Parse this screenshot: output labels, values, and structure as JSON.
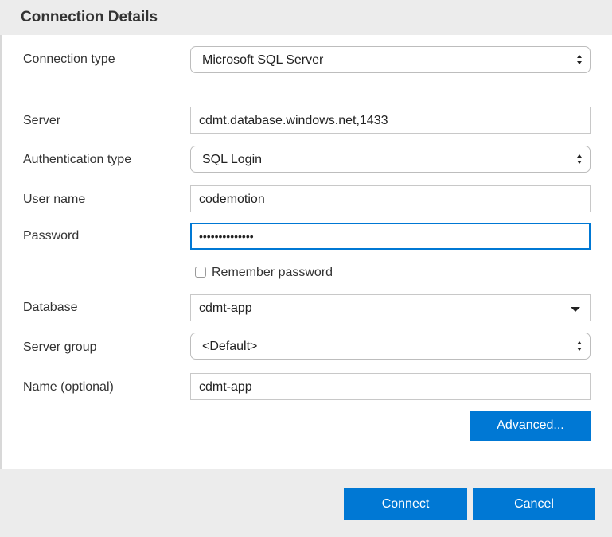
{
  "header": {
    "title": "Connection Details"
  },
  "form": {
    "connection_type": {
      "label": "Connection type",
      "value": "Microsoft SQL Server"
    },
    "server": {
      "label": "Server",
      "value": "cdmt.database.windows.net,1433"
    },
    "auth_type": {
      "label": "Authentication type",
      "value": "SQL Login"
    },
    "user_name": {
      "label": "User name",
      "value": "codemotion"
    },
    "password": {
      "label": "Password",
      "value": "••••••••••••••"
    },
    "remember_password": {
      "label": "Remember password",
      "checked": false
    },
    "database": {
      "label": "Database",
      "value": "cdmt-app"
    },
    "server_group": {
      "label": "Server group",
      "value": "<Default>"
    },
    "name": {
      "label": "Name (optional)",
      "value": "cdmt-app"
    }
  },
  "buttons": {
    "advanced": "Advanced...",
    "connect": "Connect",
    "cancel": "Cancel"
  },
  "colors": {
    "accent": "#0078d4",
    "header_bg": "#ececec",
    "footer_bg": "#ececec"
  },
  "icons": {
    "select_arrows": "updown-chevrons-icon",
    "dropdown": "caret-down-icon"
  }
}
